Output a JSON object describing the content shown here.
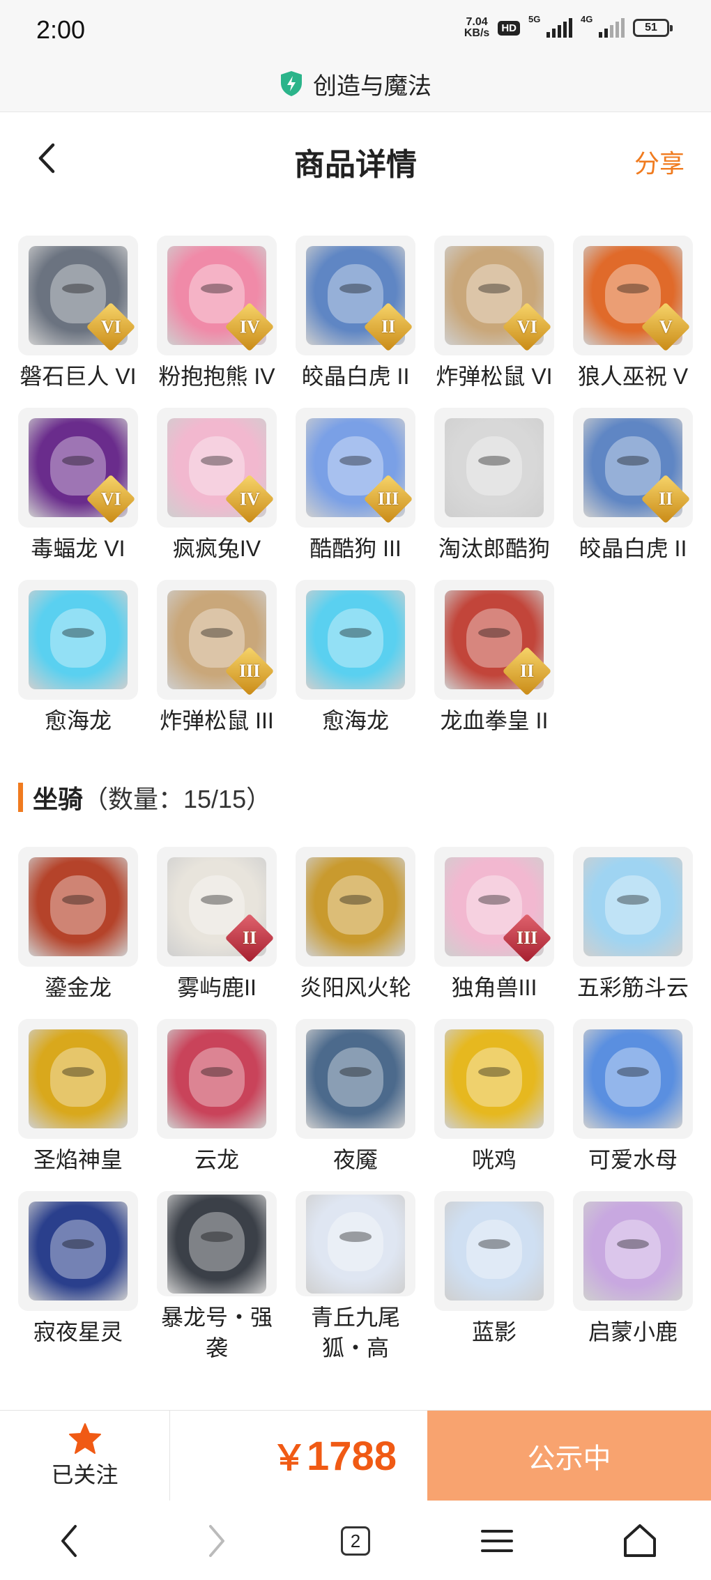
{
  "status_bar": {
    "time": "2:00",
    "net_speed_value": "7.04",
    "net_speed_unit": "KB/s",
    "hd_label": "HD",
    "signal1_label": "5G",
    "signal2_label": "4G",
    "battery": "51"
  },
  "app": {
    "title": "创造与魔法",
    "icon": "shield-bolt-icon",
    "accent": "#2bb48a"
  },
  "header": {
    "title": "商品详情",
    "share_label": "分享",
    "back_icon": "chevron-left-icon",
    "accent_color": "#f07b1f"
  },
  "pets": [
    {
      "name": "磐石巨人 VI",
      "tier": "VI",
      "color": "#6b7380"
    },
    {
      "name": "粉抱抱熊 IV",
      "tier": "IV",
      "color": "#f08aa8"
    },
    {
      "name": "皎晶白虎 II",
      "tier": "II",
      "color": "#5f86c4"
    },
    {
      "name": "炸弹松鼠 VI",
      "tier": "VI",
      "color": "#c9a77a"
    },
    {
      "name": "狼人巫祝 V",
      "tier": "V",
      "color": "#e06a2a"
    },
    {
      "name": "毒蝠龙 VI",
      "tier": "VI",
      "color": "#6a2c8c"
    },
    {
      "name": "疯疯兔IV",
      "tier": "IV",
      "color": "#f2b8cf"
    },
    {
      "name": "酷酷狗 III",
      "tier": "III",
      "color": "#7aa0e6"
    },
    {
      "name": "淘汰郎酷狗",
      "tier": "",
      "color": "#d8d8d8"
    },
    {
      "name": "皎晶白虎 II",
      "tier": "II",
      "color": "#5f86c4"
    },
    {
      "name": "愈海龙",
      "tier": "",
      "color": "#5ad0f0"
    },
    {
      "name": "炸弹松鼠 III",
      "tier": "III",
      "color": "#c9a77a"
    },
    {
      "name": "愈海龙",
      "tier": "",
      "color": "#5ad0f0"
    },
    {
      "name": "龙血拳皇 II",
      "tier": "II",
      "color": "#c2453a"
    }
  ],
  "mounts_section": {
    "title": "坐骑",
    "count_text": "（数量：15/15）"
  },
  "mounts": [
    {
      "name": "鎏金龙",
      "tier": "",
      "color": "#b5432a"
    },
    {
      "name": "雾屿鹿II",
      "tier": "II",
      "tier_style": "red",
      "color": "#e8e4dc"
    },
    {
      "name": "炎阳风火轮",
      "tier": "",
      "color": "#c99a2e"
    },
    {
      "name": "独角兽III",
      "tier": "III",
      "tier_style": "red",
      "color": "#f2b8d0"
    },
    {
      "name": "五彩筋斗云",
      "tier": "",
      "color": "#9fd4f2"
    },
    {
      "name": "圣焰神皇",
      "tier": "",
      "color": "#d9a81c"
    },
    {
      "name": "云龙",
      "tier": "",
      "color": "#c9435a"
    },
    {
      "name": "夜魇",
      "tier": "",
      "color": "#4c6a8c"
    },
    {
      "name": "咣鸡",
      "tier": "",
      "color": "#e6b81f"
    },
    {
      "name": "可爱水母",
      "tier": "",
      "color": "#5a8fe0"
    },
    {
      "name": "寂夜星灵",
      "tier": "",
      "color": "#2a3f8c"
    },
    {
      "name": "暴龙号・强袭",
      "tier": "",
      "color": "#3b4048"
    },
    {
      "name": "青丘九尾狐・高",
      "tier": "",
      "color": "#dfe6f2"
    },
    {
      "name": "蓝影",
      "tier": "",
      "color": "#cfdff2"
    },
    {
      "name": "启蒙小鹿",
      "tier": "",
      "color": "#c8a8e0"
    }
  ],
  "action_bar": {
    "follow_label": "已关注",
    "follow_icon": "star-icon",
    "currency": "￥",
    "price": "1788",
    "status_label": "公示中",
    "price_color": "#f05a14",
    "status_bg": "#f8a36f"
  },
  "system_nav": {
    "back_icon": "nav-back-icon",
    "forward_icon": "nav-forward-icon",
    "tabs_count": "2",
    "menu_icon": "menu-icon",
    "home_icon": "home-icon"
  }
}
